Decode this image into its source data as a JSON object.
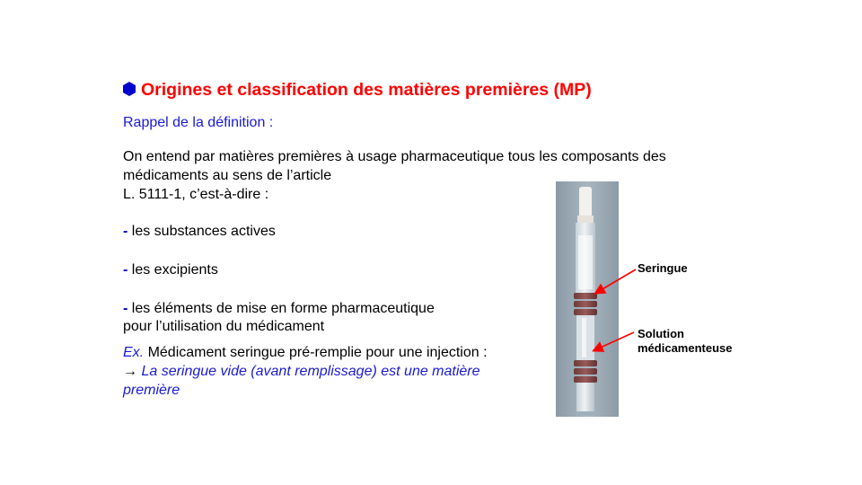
{
  "slide": {
    "title": "Origines et classification des matières premières (MP)",
    "subtitle": "Rappel de la définition :",
    "definition": {
      "line1": "On entend par matières premières à usage pharmaceutique tous les composants des",
      "line2": "médicaments au sens de l’article",
      "line3": "L. 5111-1, c’est-à-dire :"
    },
    "items": [
      {
        "dash": "-",
        "line1": " les substances actives",
        "line2": ""
      },
      {
        "dash": "-",
        "line1": " les excipients",
        "line2": ""
      },
      {
        "dash": "-",
        "line1": " les éléments de mise en forme pharmaceutique",
        "line2": "pour l’utilisation du médicament"
      }
    ],
    "example": {
      "prefix": "Ex.",
      "text": " Médicament seringue pré-remplie pour une injection :",
      "arrow": "→",
      "conclusion_line1": " La seringue vide (avant remplissage) est une matière",
      "conclusion_line2": "première"
    },
    "figure": {
      "label_syringe": "Seringue",
      "label_solution_line1": "Solution",
      "label_solution_line2": "médicamenteuse"
    },
    "colors": {
      "title": "#ff0000",
      "accent_blue": "#1a1ad4",
      "arrow_red": "#ff0000"
    }
  }
}
